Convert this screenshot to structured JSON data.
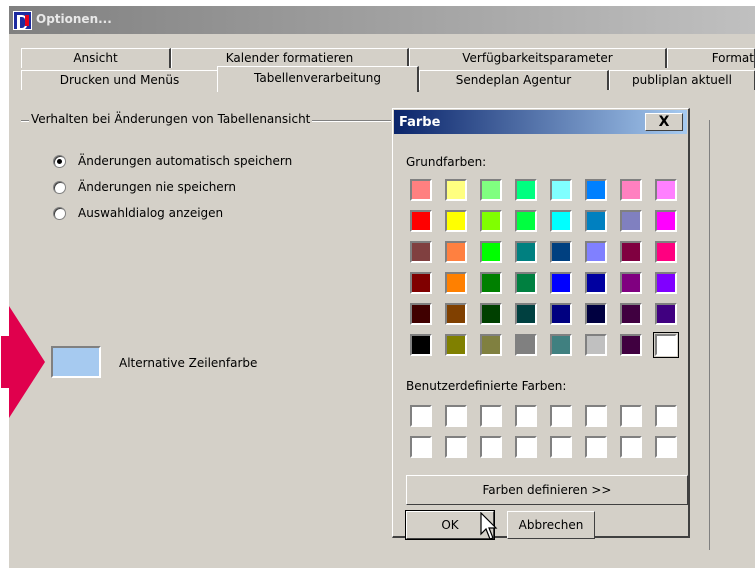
{
  "window": {
    "title": "Optionen..."
  },
  "tabs_row1": [
    {
      "label": "Ansicht",
      "selected": false
    },
    {
      "label": "Kalender formatieren",
      "selected": false
    },
    {
      "label": "Verfügbarkeitsparameter",
      "selected": false
    },
    {
      "label": "Format",
      "selected": false
    }
  ],
  "tabs_row2": [
    {
      "label": "Drucken und Menüs",
      "selected": false
    },
    {
      "label": "Tabellenverarbeitung",
      "selected": true
    },
    {
      "label": "Sendeplan Agentur",
      "selected": false
    },
    {
      "label": "publiplan aktuell",
      "selected": false
    }
  ],
  "group": {
    "label": "Verhalten bei Änderungen von Tabellenansicht",
    "options": [
      {
        "label": "Änderungen automatisch speichern",
        "checked": true
      },
      {
        "label": "Änderungen nie speichern",
        "checked": false
      },
      {
        "label": "Auswahldialog anzeigen",
        "checked": false
      }
    ]
  },
  "alt_row": {
    "label": "Alternative Zeilenfarbe",
    "color": "#a6caf0"
  },
  "arrow_color": "#e0004d",
  "dialog": {
    "title": "Farbe",
    "close_label": "X",
    "basic_label": "Grundfarben:",
    "basic_colors": [
      [
        "#ff8080",
        "#ffff80",
        "#80ff80",
        "#00ff80",
        "#80ffff",
        "#0080ff",
        "#ff80c0",
        "#ff80ff"
      ],
      [
        "#ff0000",
        "#ffff00",
        "#80ff00",
        "#00ff40",
        "#00ffff",
        "#0080c0",
        "#8080c0",
        "#ff00ff"
      ],
      [
        "#804040",
        "#ff8040",
        "#00ff00",
        "#008080",
        "#004080",
        "#8080ff",
        "#800040",
        "#ff0080"
      ],
      [
        "#800000",
        "#ff8000",
        "#008000",
        "#008040",
        "#0000ff",
        "#0000a0",
        "#800080",
        "#8000ff"
      ],
      [
        "#400000",
        "#804000",
        "#004000",
        "#004040",
        "#000080",
        "#000040",
        "#400040",
        "#400080"
      ],
      [
        "#000000",
        "#808000",
        "#808040",
        "#808080",
        "#408080",
        "#c0c0c0",
        "#400040",
        "#ffffff"
      ]
    ],
    "selected_cell": [
      5,
      7
    ],
    "custom_label": "Benutzerdefinierte Farben:",
    "custom_colors": [
      [
        "#ffffff",
        "#ffffff",
        "#ffffff",
        "#ffffff",
        "#ffffff",
        "#ffffff",
        "#ffffff",
        "#ffffff"
      ],
      [
        "#ffffff",
        "#ffffff",
        "#ffffff",
        "#ffffff",
        "#ffffff",
        "#ffffff",
        "#ffffff",
        "#ffffff"
      ]
    ],
    "define_label": "Farben definieren >>",
    "ok_label": "OK",
    "cancel_label": "Abbrechen"
  }
}
